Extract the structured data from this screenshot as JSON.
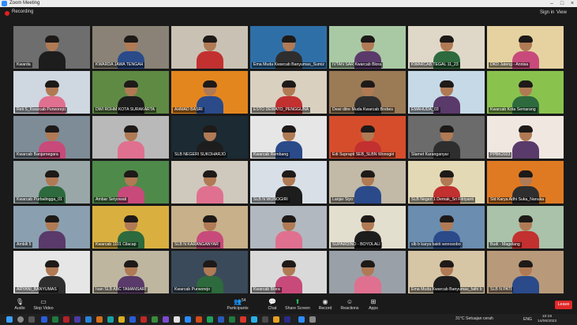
{
  "window": {
    "title": "Zoom Meeting",
    "recording_label": "Recording",
    "sign_in": "Sign in",
    "view": "View"
  },
  "participants": [
    "Kwarda",
    "KWARDA JAWA TENGAH",
    "",
    "Ema Muda Kwarcab Banyumas_Sumiz",
    "IVTAN SAR Kwarcab Blora",
    "KWARCAB TEGAL 11_23",
    "DKD Jateng - Annisa",
    "Reli S_Kwarcab Purworejo",
    "DWI ROHM KOTA SURAKARTA",
    "AHMAD BASRI",
    "ESTO DEWATO_PENGGUNA",
    "Dewi ditre Muda Kwarcab Brebes",
    "EMAHUDA_03",
    "Kwarcab Kota Semarang",
    "Kwarcab Banjarnegara",
    "",
    "SLB NEGERI SUKOHARJO",
    "Kwarcab Rembang",
    "Edi Suprapti SEB_SLBN Wonogiri",
    "Slamet Karanganyar",
    "PPBK2023",
    "Kwarcab Purbalingga_01",
    "Ambar Setyowati",
    "",
    "SLB N WONOGIRI",
    "Lanjar Siyo",
    "SLB Negeri 1 Demak_Sri Fitriyanti",
    "Sld Karya Adhi Suka_Nanuka",
    "Ambili 5",
    "Kwarcab 1101 Cilacap",
    "SLB N KARANGANYAR",
    "",
    "SUPARDINO - BOYOLALI",
    "slb b karya bakti wonosobo",
    "Budi - Magelang",
    "ARYANI_BANYUMAS",
    "Ivan SLB ABC TAMANSARI",
    "Kwarcab Purworejo",
    "Kwarcab Blora",
    "",
    "Ema Muda Kwarcab Banyumas_fathi b",
    "SLB N PATI",
    "",
    "Shabilayatorera",
    "Ema Ahni Kwarcab Kalten",
    "SLB NEGERI WIRADESA",
    "Hamidah_SLB Radhiyah Limmah",
    "SLB N BRAMAKAS"
  ],
  "toolbar": [
    {
      "label": "Audio",
      "icon": "microphone-icon"
    },
    {
      "label": "Stop Video",
      "icon": "video-icon"
    },
    {
      "label": "Participants",
      "icon": "participants-icon",
      "count": "54"
    },
    {
      "label": "Chat",
      "icon": "chat-icon"
    },
    {
      "label": "Share Screen",
      "icon": "share-screen-icon"
    },
    {
      "label": "Record",
      "icon": "record-icon"
    },
    {
      "label": "Reactions",
      "icon": "reactions-icon"
    },
    {
      "label": "Apps",
      "icon": "apps-icon"
    }
  ],
  "leave_label": "Leave",
  "tray": {
    "weather": "31°C Setuajan cerah",
    "lang": "ENG",
    "time": "10:19",
    "date": "14/06/2023"
  },
  "colors": {
    "accent": "#2d8cff",
    "leave": "#e02828",
    "speaker_border": "#f5d200",
    "share": "#27c15a"
  }
}
